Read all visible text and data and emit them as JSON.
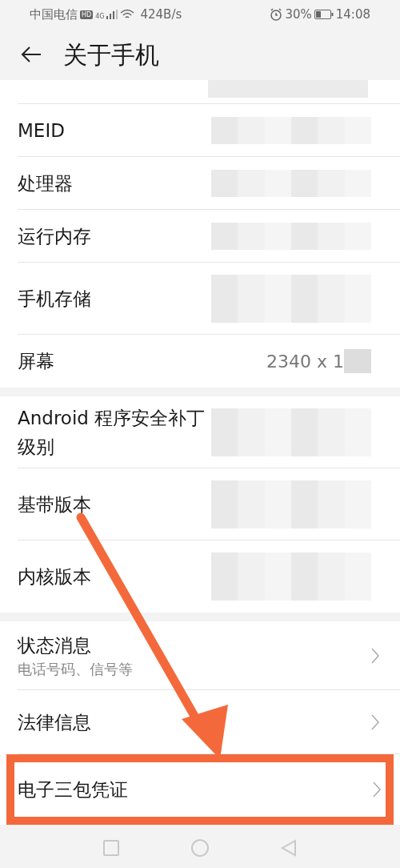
{
  "status_bar": {
    "carrier": "中国电信",
    "hd": "HD",
    "network": "4G",
    "speed": "424B/s",
    "battery": "30%",
    "time": "14:08"
  },
  "title": "关于手机",
  "sections": [
    {
      "rows": [
        {
          "kind": "info",
          "redacted": true
        },
        {
          "kind": "info",
          "label": "MEID",
          "redacted": true
        },
        {
          "kind": "info",
          "label": "处理器",
          "redacted": true
        },
        {
          "kind": "info",
          "label": "运行内存",
          "redacted": true
        },
        {
          "kind": "info",
          "label": "手机存储",
          "redacted": true,
          "tall": true
        },
        {
          "kind": "info",
          "label": "屏幕",
          "value": "2340 x 1",
          "redacted": true
        }
      ]
    },
    {
      "rows": [
        {
          "kind": "info",
          "label": "Android 程序安全补丁级别",
          "redacted": true,
          "tall": true
        },
        {
          "kind": "info",
          "label": "基带版本",
          "redacted": true,
          "tall": true
        },
        {
          "kind": "info",
          "label": "内核版本",
          "redacted": true,
          "tall": true
        }
      ]
    },
    {
      "rows": [
        {
          "kind": "link",
          "label": "状态消息",
          "subtitle": "电话号码、信号等",
          "highlighted": false
        },
        {
          "kind": "link",
          "label": "法律信息",
          "highlighted": false
        },
        {
          "kind": "link",
          "label": "电子三包凭证",
          "highlighted": true
        }
      ]
    }
  ]
}
